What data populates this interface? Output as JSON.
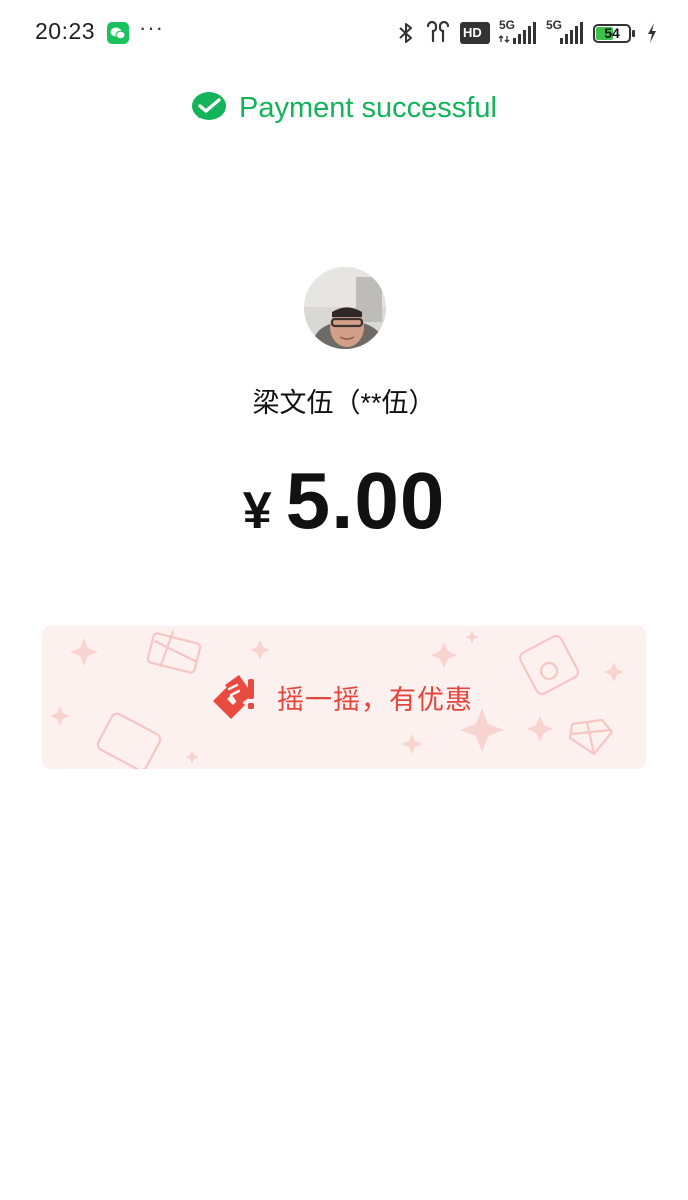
{
  "status_bar": {
    "time": "20:23",
    "battery_percent": "54",
    "battery_level": 0.54,
    "network_1": "5G",
    "network_2": "5G",
    "hd_label": "HD",
    "icons": [
      "wechat-icon",
      "more-dots-icon",
      "bluetooth-icon",
      "earbuds-icon",
      "hd-voice-icon",
      "signal-icon",
      "signal-icon",
      "battery-icon",
      "charging-icon"
    ]
  },
  "header": {
    "title": "Payment successful",
    "icon": "wechat-pay-check-icon",
    "color": "#13b35a"
  },
  "payee": {
    "name": "梁文伍（**伍）"
  },
  "amount": {
    "currency": "¥",
    "value": "5.00"
  },
  "promo": {
    "label": "摇一摇，有优惠",
    "icon": "coupon-ticket-icon",
    "accent": "#e6453d",
    "background": "#fdf1f0"
  }
}
